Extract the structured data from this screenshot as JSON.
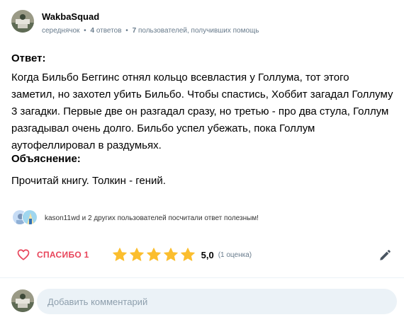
{
  "author": {
    "name": "WakbaSquad",
    "rank": "середнячок",
    "answers_count": "4",
    "answers_label": "ответов",
    "helped_count": "7",
    "helped_label": "пользователей, получивших помощь",
    "separator": "•"
  },
  "answer": {
    "title": "Ответ:",
    "text": "Когда Бильбо Беггинс отнял кольцо всевластия у Голлума, тот этого заметил, но захотел убить Бильбо. Чтобы спастись, Хоббит загадал Голлуму 3 загадки. Первые две он разгадал сразу, но третью - про два стула, Голлум разгадывал очень долго. Бильбо успел убежать, пока Голлум аутофеллировал в раздумьях."
  },
  "explanation": {
    "title": "Объяснение:",
    "text": "Прочитай книгу. Толкин - гений."
  },
  "thanks_info": {
    "text": "kason11wd и 2 других пользователей посчитали ответ полезным!"
  },
  "actions": {
    "thanks_label": "СПАСИБО 1",
    "rating_value": "5,0",
    "rating_count": "(1 оценка)",
    "stars_filled": 5,
    "stars_total": 5
  },
  "comment": {
    "placeholder": "Добавить комментарий"
  },
  "colors": {
    "accent_red": "#e8445a",
    "star_yellow": "#fbbe2e",
    "muted": "#687b8c",
    "input_bg": "#ebf2f7"
  },
  "icons": [
    "heart-icon",
    "star-icon",
    "pencil-icon"
  ]
}
